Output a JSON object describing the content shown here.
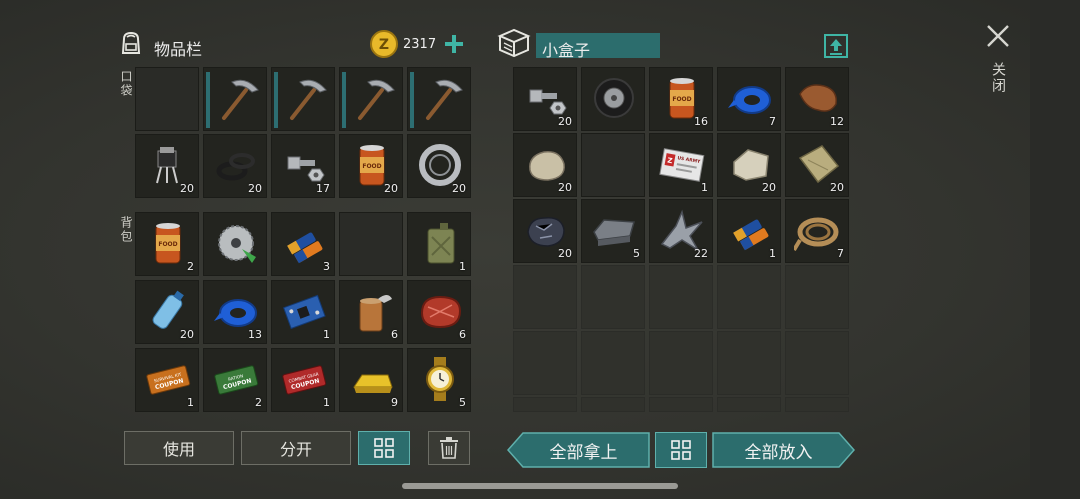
{
  "inventory": {
    "title": "物品栏",
    "coins": "2317",
    "pocket_label": "口袋",
    "backpack_label": "背包",
    "pocket_rows": [
      [
        {
          "icon": "empty-slot",
          "qty": ""
        },
        {
          "icon": "pickaxe-icon",
          "qty": ""
        },
        {
          "icon": "pickaxe-icon",
          "qty": ""
        },
        {
          "icon": "pickaxe-icon",
          "qty": ""
        },
        {
          "icon": "pickaxe-icon",
          "qty": ""
        }
      ],
      [
        {
          "icon": "transistor-icon",
          "qty": "20"
        },
        {
          "icon": "rubber-rings-icon",
          "qty": "20"
        },
        {
          "icon": "bolt-nut-icon",
          "qty": "17"
        },
        {
          "icon": "canned-food-icon",
          "qty": "20"
        },
        {
          "icon": "ball-bearing-icon",
          "qty": "20"
        }
      ]
    ],
    "backpack_rows": [
      [
        {
          "icon": "canned-food-icon",
          "qty": "2"
        },
        {
          "icon": "saw-blade-icon",
          "qty": ""
        },
        {
          "icon": "batteries-icon",
          "qty": "3"
        },
        {
          "icon": "empty-slot",
          "qty": ""
        },
        {
          "icon": "jerrycan-icon",
          "qty": "1"
        }
      ],
      [
        {
          "icon": "water-bottle-icon",
          "qty": "20"
        },
        {
          "icon": "duct-tape-icon",
          "qty": "13"
        },
        {
          "icon": "circuit-board-icon",
          "qty": "1"
        },
        {
          "icon": "open-can-icon",
          "qty": "6"
        },
        {
          "icon": "raw-steak-icon",
          "qty": "6"
        }
      ],
      [
        {
          "icon": "coupon-orange-icon",
          "qty": "1"
        },
        {
          "icon": "coupon-green-icon",
          "qty": "2"
        },
        {
          "icon": "coupon-red-icon",
          "qty": "1"
        },
        {
          "icon": "gold-bar-icon",
          "qty": "9"
        },
        {
          "icon": "gold-watch-icon",
          "qty": "5"
        }
      ]
    ],
    "use_label": "使用",
    "split_label": "分开"
  },
  "container": {
    "title": "小盒子",
    "rows": [
      [
        {
          "icon": "bolt-nut-icon",
          "qty": "20"
        },
        {
          "icon": "tire-icon",
          "qty": ""
        },
        {
          "icon": "canned-food-icon",
          "qty": "16"
        },
        {
          "icon": "duct-tape-icon",
          "qty": "7"
        },
        {
          "icon": "leather-icon",
          "qty": "12"
        }
      ],
      [
        {
          "icon": "stone-icon",
          "qty": "20"
        },
        {
          "icon": "empty-slot",
          "qty": ""
        },
        {
          "icon": "army-id-card-icon",
          "qty": "1",
          "card_text": "US ARMY"
        },
        {
          "icon": "limestone-icon",
          "qty": "20"
        },
        {
          "icon": "cloth-icon",
          "qty": "20"
        }
      ],
      [
        {
          "icon": "iron-ore-icon",
          "qty": "20"
        },
        {
          "icon": "iron-ingot-icon",
          "qty": "5"
        },
        {
          "icon": "scrap-metal-icon",
          "qty": "22"
        },
        {
          "icon": "batteries-icon",
          "qty": "1"
        },
        {
          "icon": "rope-icon",
          "qty": "7"
        }
      ]
    ],
    "take_all_label": "全部拿上",
    "put_all_label": "全部放入"
  },
  "close_label": "关闭",
  "coupon_texts": {
    "orange": "SURVIVAL KIT COUPON",
    "green": "RATION COUPON",
    "red": "COMBAT GEAR COUPON"
  },
  "colors": {
    "teal_button": "#2c6d6d",
    "coin_gold": "#e8b92a",
    "plus_green": "#3fb5a5"
  }
}
